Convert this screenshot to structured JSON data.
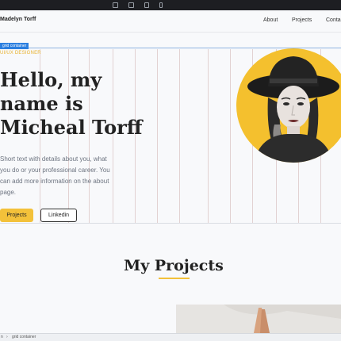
{
  "editor": {
    "devices": [
      "desktop-icon",
      "laptop-icon",
      "tablet-icon",
      "phone-icon"
    ],
    "grid_badge": "grid container",
    "breadcrumb_root": "n",
    "breadcrumb_current": "grid container"
  },
  "nav": {
    "brand": "Madelyn Torff",
    "links": [
      "About",
      "Projects",
      "Conta"
    ]
  },
  "hero": {
    "role": "UI/UX DESIGNER",
    "headline": [
      "Hello, my",
      "name is",
      "Micheal Torff"
    ],
    "bio": [
      "Short text with details about you, what",
      "you do or your professional career. You",
      "can add more information on the about",
      "page."
    ],
    "primary_button": "Projects",
    "secondary_button": "Linkedin"
  },
  "projects": {
    "title": "My Projects"
  },
  "colors": {
    "accent": "#f3c13a",
    "grid_badge": "#2b7fe0",
    "editor_bar": "#1d1e22"
  }
}
